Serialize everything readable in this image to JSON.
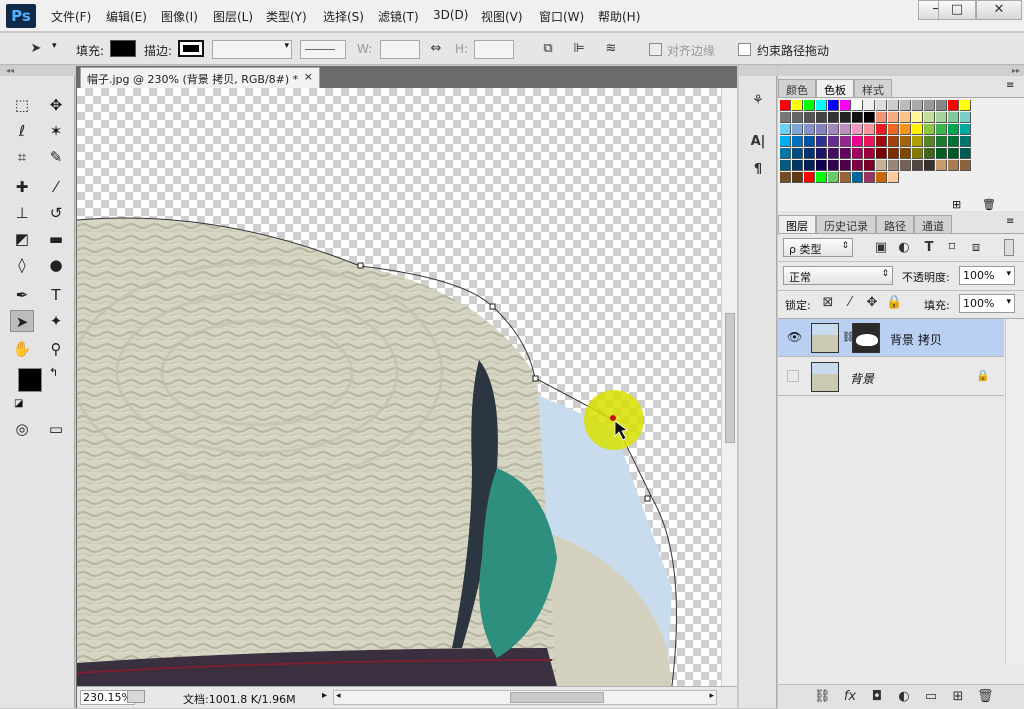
{
  "app": {
    "logo": "Ps"
  },
  "menu": [
    "文件(F)",
    "编辑(E)",
    "图像(I)",
    "图层(L)",
    "类型(Y)",
    "选择(S)",
    "滤镜(T)",
    "3D(D)",
    "视图(V)",
    "窗口(W)",
    "帮助(H)"
  ],
  "window_controls": {
    "minimize": "─",
    "maximize": "□",
    "close": "✕"
  },
  "options": {
    "fill_label": "填充:",
    "stroke_label": "描边:",
    "w_label": "W:",
    "h_label": "H:",
    "align_edges": "对齐边缘",
    "constrain_path": "约束路径拖动",
    "fill_color": "#000000"
  },
  "document": {
    "tab_title": "帽子.jpg @ 230% (背景 拷贝, RGB/8#) *",
    "close": "×",
    "zoom": "230.15%",
    "doc_info": "文档:1001.8 K/1.96M"
  },
  "swatches_panel": {
    "tabs": [
      "颜色",
      "色板",
      "样式"
    ],
    "active_tab": "色板"
  },
  "layers_panel": {
    "tabs": [
      "图层",
      "历史记录",
      "路径",
      "通道"
    ],
    "filter_label": "ρ 类型",
    "blend_mode": "正常",
    "opacity_label": "不透明度:",
    "opacity": "100%",
    "lock_label": "锁定:",
    "fill_label": "填充:",
    "fill": "100%",
    "layers": [
      {
        "name": "背景 拷贝",
        "visible": true,
        "selected": true
      },
      {
        "name": "背景",
        "visible": false,
        "selected": false
      }
    ]
  },
  "colors": {
    "accent_selected": "#bad0f3",
    "highlight_circle": "#d8e000"
  }
}
